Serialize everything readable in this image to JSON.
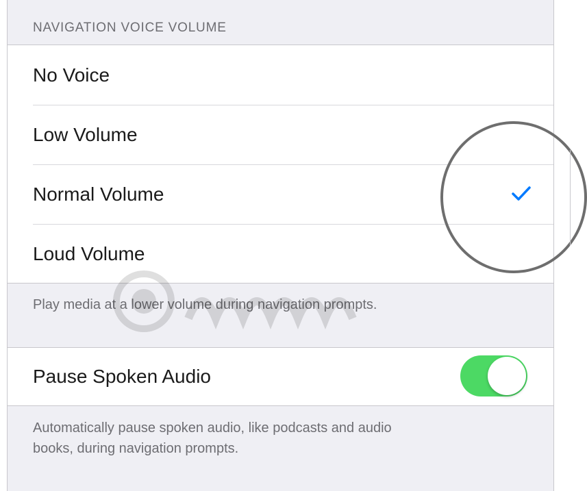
{
  "header": {
    "title": "NAVIGATION VOICE VOLUME"
  },
  "volume_options": [
    {
      "label": "No Voice",
      "selected": false
    },
    {
      "label": "Low Volume",
      "selected": false
    },
    {
      "label": "Normal Volume",
      "selected": true
    },
    {
      "label": "Loud Volume",
      "selected": false
    }
  ],
  "volume_footer": "Play media at a lower volume during navigation prompts.",
  "pause_audio": {
    "label": "Pause Spoken Audio",
    "enabled": true,
    "footer_line1": "Automatically pause spoken audio, like podcasts and audio",
    "footer_line2": "books, during navigation prompts."
  },
  "colors": {
    "accent": "#007aff",
    "toggle_on": "#4cd964",
    "group_background": "#efeff4"
  },
  "icons": {
    "selected_marker": "checkmark-icon"
  }
}
